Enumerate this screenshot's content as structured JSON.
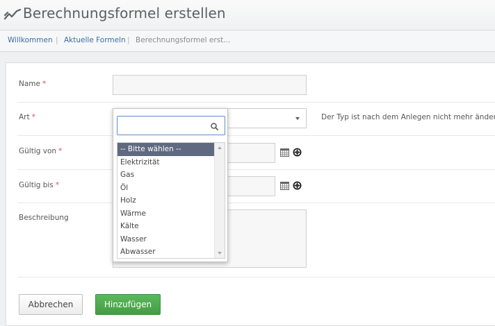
{
  "page": {
    "title": "Berechnungsformel erstellen",
    "title_icon": "chart-line-icon"
  },
  "breadcrumb": {
    "items": [
      "Willkommen",
      "Aktuelle Formeln",
      "Berechnungsformel erst..."
    ],
    "separator": "|"
  },
  "form": {
    "name": {
      "label": "Name",
      "required_mark": "*",
      "value": ""
    },
    "art": {
      "label": "Art",
      "required_mark": "*",
      "hint": "Der Typ ist nach dem Anlegen nicht mehr änderbar."
    },
    "gueltig_von": {
      "label": "Gültig von",
      "required_mark": "*",
      "value": ""
    },
    "gueltig_bis": {
      "label": "Gültig bis",
      "required_mark": "*",
      "value": ""
    },
    "beschreibung": {
      "label": "Beschreibung",
      "value": ""
    }
  },
  "dropdown": {
    "search_value": "",
    "selected_index": 0,
    "options": [
      "-- Bitte wählen --",
      "Elektrizität",
      "Gas",
      "Öl",
      "Holz",
      "Wärme",
      "Kälte",
      "Wasser",
      "Abwasser"
    ]
  },
  "buttons": {
    "cancel": "Abbrechen",
    "add": "Hinzufügen"
  },
  "colors": {
    "accent_blue": "#3a6da8",
    "selected_option": "#5f6a80",
    "primary_green": "#5cb85c",
    "required_red": "#d9534f"
  }
}
